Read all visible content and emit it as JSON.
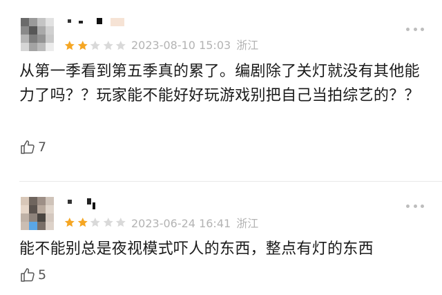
{
  "comments": [
    {
      "rating": 2,
      "max_rating": 5,
      "date": "2023-08-10 15:03",
      "location": "浙江",
      "text": "从第一季看到第五季真的累了。编剧除了关灯就没有其他能力了吗？？玩家能不能好好玩游戏别把自己当拍综艺的？？",
      "likes": "7"
    },
    {
      "rating": 2,
      "max_rating": 5,
      "date": "2023-06-24 16:41",
      "location": "浙江",
      "text": "能不能别总是夜视模式吓人的东西，整点有灯的东西",
      "likes": "5"
    }
  ],
  "colors": {
    "star_filled": "#f5a623",
    "star_empty": "#d9d9d9",
    "meta": "#b3b3b3"
  },
  "icons": {
    "like": "thumbs-up-icon",
    "more": "more-dots-icon",
    "star": "star-icon"
  }
}
